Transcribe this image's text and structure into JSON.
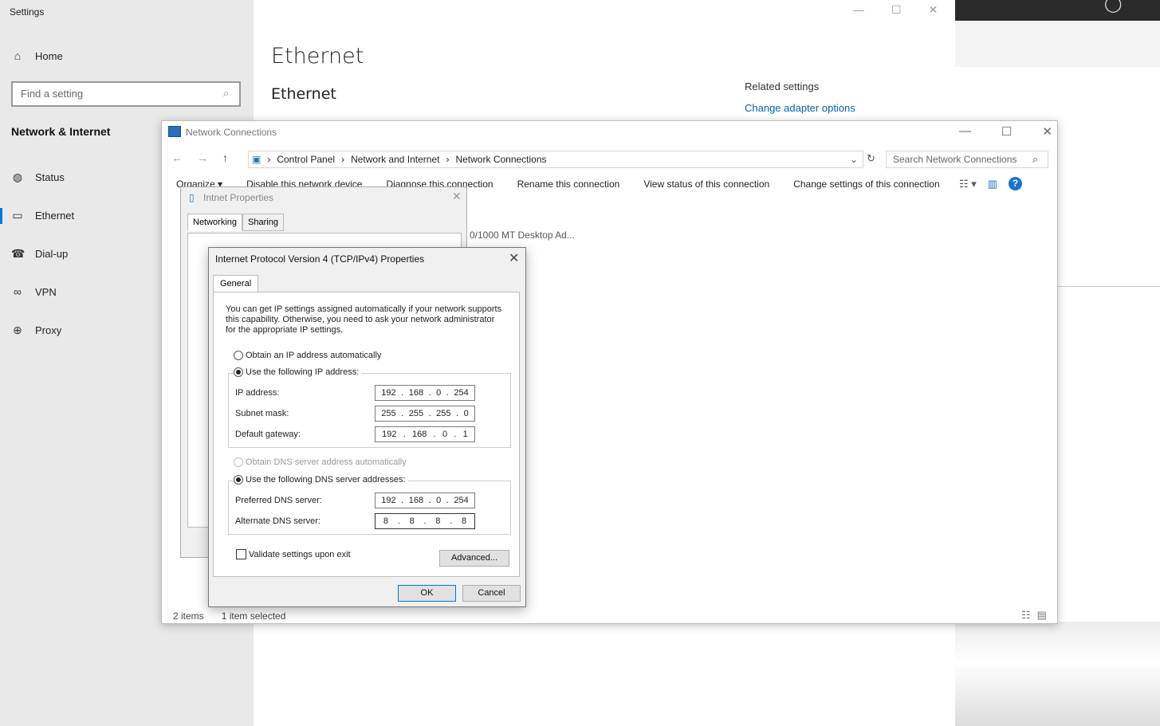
{
  "settings": {
    "title": "Settings",
    "home": "Home",
    "search_placeholder": "Find a setting",
    "section": "Network & Internet",
    "nav": [
      {
        "label": "Status",
        "icon": "globe-status-icon"
      },
      {
        "label": "Ethernet",
        "icon": "ethernet-icon"
      },
      {
        "label": "Dial-up",
        "icon": "dialup-icon"
      },
      {
        "label": "VPN",
        "icon": "vpn-icon"
      },
      {
        "label": "Proxy",
        "icon": "globe-icon"
      }
    ],
    "page_title": "Ethernet",
    "page_subtitle": "Ethernet",
    "related_heading": "Related settings",
    "related_link": "Change adapter options"
  },
  "netconn": {
    "title": "Network Connections",
    "breadcrumb": [
      "Control Panel",
      "Network and Internet",
      "Network Connections"
    ],
    "search_placeholder": "Search Network Connections",
    "toolbar": [
      "Organize ▾",
      "Disable this network device",
      "Diagnose this connection",
      "Rename this connection",
      "View status of this connection",
      "Change settings of this connection"
    ],
    "adapter_text": "0/1000 MT Desktop Ad...",
    "status_items": "2 items",
    "status_selected": "1 item selected"
  },
  "ethprops": {
    "title": "Intnet Properties",
    "tabs": [
      "Networking",
      "Sharing"
    ]
  },
  "ipv4": {
    "title": "Internet Protocol Version 4 (TCP/IPv4) Properties",
    "tab": "General",
    "description": "You can get IP settings assigned automatically if your network supports this capability. Otherwise, you need to ask your network administrator for the appropriate IP settings.",
    "auto_ip": "Obtain an IP address automatically",
    "manual_ip": "Use the following IP address:",
    "ip_label": "IP address:",
    "ip": [
      "192",
      "168",
      "0",
      "254"
    ],
    "mask_label": "Subnet mask:",
    "mask": [
      "255",
      "255",
      "255",
      "0"
    ],
    "gw_label": "Default gateway:",
    "gw": [
      "192",
      "168",
      "0",
      "1"
    ],
    "auto_dns": "Obtain DNS server address automatically",
    "manual_dns": "Use the following DNS server addresses:",
    "pdns_label": "Preferred DNS server:",
    "pdns": [
      "192",
      "168",
      "0",
      "254"
    ],
    "adns_label": "Alternate DNS server:",
    "adns": [
      "8",
      "8",
      "8",
      "8"
    ],
    "validate": "Validate settings upon exit",
    "advanced": "Advanced...",
    "ok": "OK",
    "cancel": "Cancel"
  }
}
